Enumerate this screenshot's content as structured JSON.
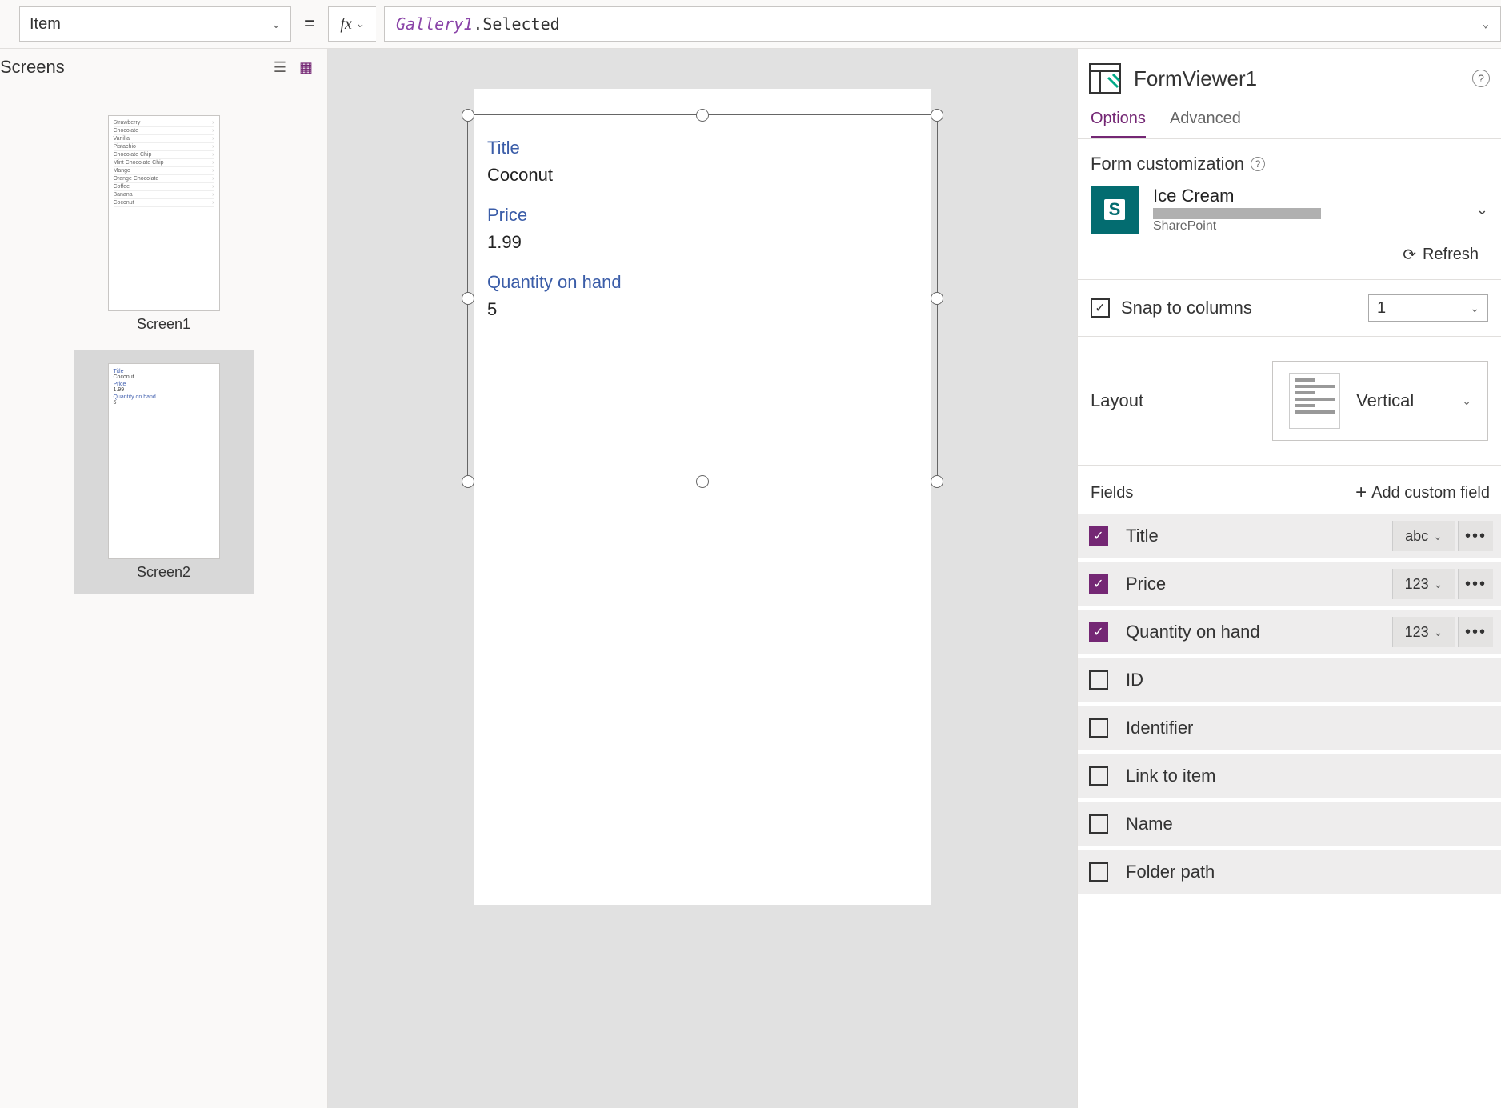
{
  "formula_bar": {
    "property": "Item",
    "identifier": "Gallery1",
    "suffix": ".Selected"
  },
  "left": {
    "title": "Screens",
    "screens": [
      {
        "name": "Screen1",
        "listItems": [
          "Strawberry",
          "Chocolate",
          "Vanilla",
          "Pistachio",
          "Chocolate Chip",
          "Mint Chocolate Chip",
          "Mango",
          "Orange Chocolate",
          "Coffee",
          "Banana",
          "Coconut"
        ]
      },
      {
        "name": "Screen2",
        "fields": [
          {
            "label": "Title",
            "value": "Coconut"
          },
          {
            "label": "Price",
            "value": "1.99"
          },
          {
            "label": "Quantity on hand",
            "value": "5"
          }
        ]
      }
    ]
  },
  "canvas": {
    "fields": [
      {
        "label": "Title",
        "value": "Coconut"
      },
      {
        "label": "Price",
        "value": "1.99"
      },
      {
        "label": "Quantity on hand",
        "value": "5"
      }
    ]
  },
  "right": {
    "title": "FormViewer1",
    "tabs": {
      "options": "Options",
      "advanced": "Advanced"
    },
    "section_form": "Form customization",
    "datasource": {
      "name": "Ice Cream",
      "source": "SharePoint"
    },
    "refresh": "Refresh",
    "snap": {
      "label": "Snap to columns",
      "cols": "1"
    },
    "layout": {
      "label": "Layout",
      "value": "Vertical"
    },
    "fields_title": "Fields",
    "add_field": "Add custom field",
    "fields": [
      {
        "name": "Title",
        "checked": true,
        "type": "abc"
      },
      {
        "name": "Price",
        "checked": true,
        "type": "123"
      },
      {
        "name": "Quantity on hand",
        "checked": true,
        "type": "123"
      },
      {
        "name": "ID",
        "checked": false
      },
      {
        "name": "Identifier",
        "checked": false
      },
      {
        "name": "Link to item",
        "checked": false
      },
      {
        "name": "Name",
        "checked": false
      },
      {
        "name": "Folder path",
        "checked": false
      }
    ]
  }
}
